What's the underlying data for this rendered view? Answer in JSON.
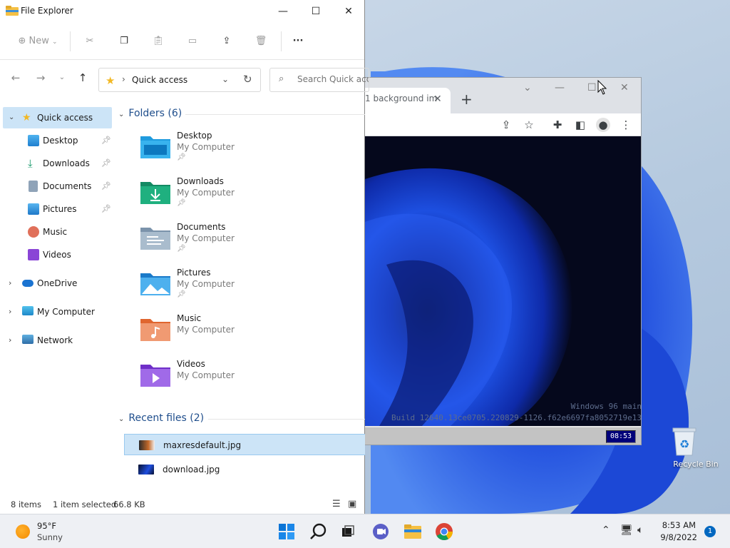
{
  "explorer": {
    "title": "File Explorer",
    "ribbon": {
      "new_label": "New"
    },
    "address": {
      "crumb": "Quick access"
    },
    "search": {
      "placeholder": "Search Quick access"
    },
    "nav": [
      {
        "label": "Quick access"
      },
      {
        "label": "Desktop"
      },
      {
        "label": "Downloads"
      },
      {
        "label": "Documents"
      },
      {
        "label": "Pictures"
      },
      {
        "label": "Music"
      },
      {
        "label": "Videos"
      },
      {
        "label": "OneDrive"
      },
      {
        "label": "My Computer"
      },
      {
        "label": "Network"
      }
    ],
    "folders_header": "Folders (6)",
    "folders": [
      {
        "name": "Desktop",
        "location": "My Computer"
      },
      {
        "name": "Downloads",
        "location": "My Computer"
      },
      {
        "name": "Documents",
        "location": "My Computer"
      },
      {
        "name": "Pictures",
        "location": "My Computer"
      },
      {
        "name": "Music",
        "location": "My Computer"
      },
      {
        "name": "Videos",
        "location": "My Computer"
      }
    ],
    "recent_header": "Recent files (2)",
    "recent": [
      {
        "name": "maxresdefault.jpg"
      },
      {
        "name": "download.jpg"
      }
    ],
    "status": {
      "items": "8 items",
      "selected": "1 item selected",
      "size": "66.8 KB"
    }
  },
  "browser": {
    "tab_title": "1 background im",
    "watermark_line1": "Windows 96 main",
    "watermark_line2": "Build 12640.13ce0705.220829-1126.f62e6697fa8052719e13",
    "clock": "08:53"
  },
  "desktop": {
    "recycle_bin": "Recycle Bin"
  },
  "taskbar": {
    "weather_temp": "95°F",
    "weather_cond": "Sunny",
    "time": "8:53 AM",
    "date": "9/8/2022",
    "notifications": "1"
  },
  "colors": {
    "accent": "#0067c0",
    "selection": "#cce4f7",
    "folder_blue": "#1f9bde"
  }
}
